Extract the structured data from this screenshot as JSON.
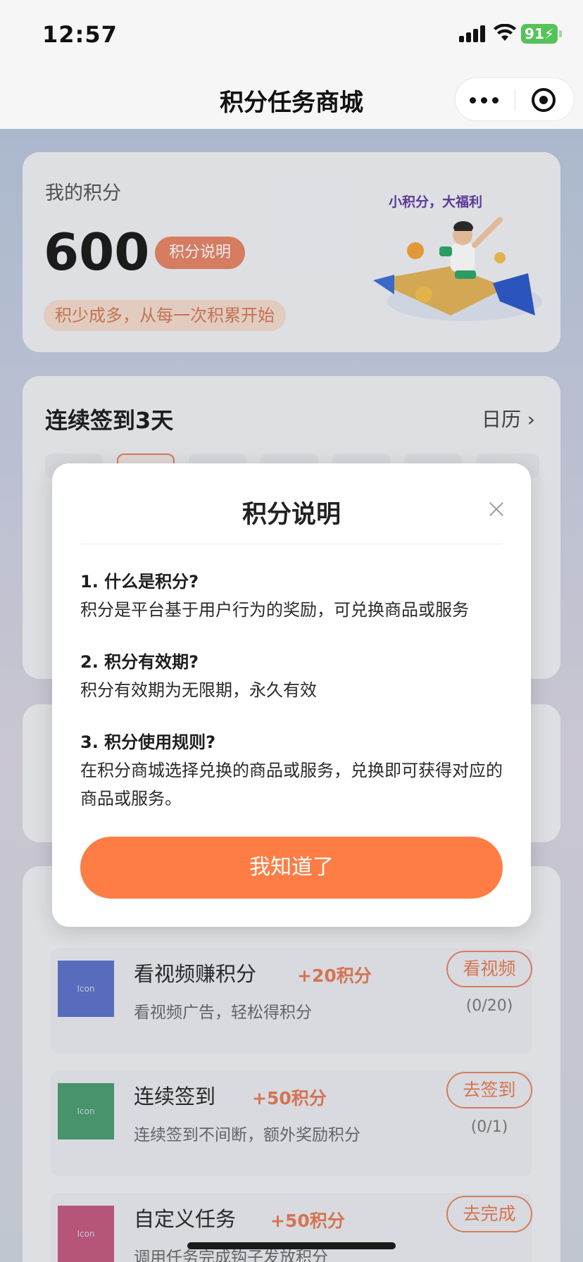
{
  "status_bar": {
    "time": "12:57",
    "battery": "91"
  },
  "nav": {
    "title": "积分任务商城"
  },
  "points": {
    "label": "我的积分",
    "value": "600",
    "explain_button": "积分说明",
    "slogan": "积少成多，从每一次积累开始",
    "banner_tag": "小积分，大福利"
  },
  "checkin": {
    "title": "连续签到3天",
    "calendar_link": "日历 ›"
  },
  "tasks": [
    {
      "icon_label": "Icon",
      "title": "看视频赚积分",
      "points": "+20积分",
      "desc": "看视频广告，轻松得积分",
      "button": "看视频",
      "count": "(0/20)",
      "icon_color": "#3553d8"
    },
    {
      "icon_label": "Icon",
      "title": "连续签到",
      "points": "+50积分",
      "desc": "连续签到不间断，额外奖励积分",
      "button": "去签到",
      "count": "(0/1)",
      "icon_color": "#1f9d57"
    },
    {
      "icon_label": "Icon",
      "title": "自定义任务",
      "points": "+50积分",
      "desc": "调用任务完成钩子发放积分",
      "button": "去完成",
      "count": "",
      "icon_color": "#d8336b"
    }
  ],
  "modal": {
    "title": "积分说明",
    "q1": "1. 什么是积分?",
    "a1": "积分是平台基于用户行为的奖励，可兑换商品或服务",
    "q2": "2. 积分有效期?",
    "a2": "积分有效期为无限期，永久有效",
    "q3": "3. 积分使用规则?",
    "a3": "在积分商城选择兑换的商品或服务，兑换即可获得对应的商品或服务。",
    "confirm_button": "我知道了"
  },
  "colors": {
    "accent": "#fd7d45",
    "points_text": "#e47c56"
  }
}
